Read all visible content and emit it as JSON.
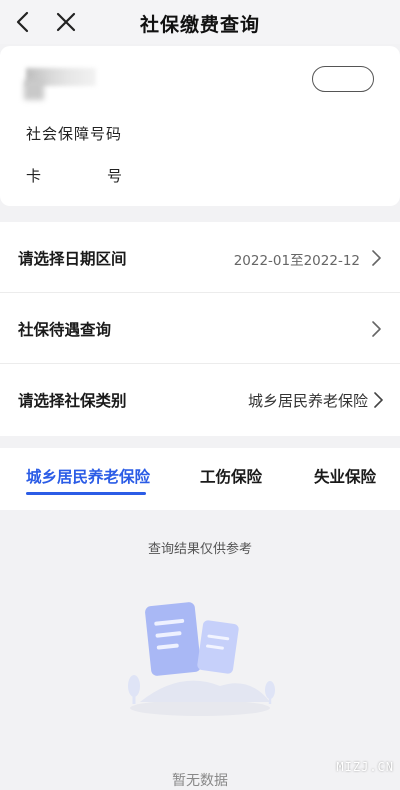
{
  "nav": {
    "title": "社保缴费查询"
  },
  "user": {
    "social_security_label": "社会保障号码",
    "card_label_left": "卡",
    "card_label_right": "号"
  },
  "rows": [
    {
      "label": "请选择日期区间",
      "value": "2022-01至2022-12"
    },
    {
      "label": "社保待遇查询",
      "value": ""
    },
    {
      "label": "请选择社保类别",
      "value": "城乡居民养老保险"
    }
  ],
  "tabs": [
    {
      "label": "城乡居民养老保险",
      "active": true
    },
    {
      "label": "工伤保险",
      "active": false
    },
    {
      "label": "失业保险",
      "active": false
    }
  ],
  "results": {
    "notice": "查询结果仅供参考",
    "empty": "暂无数据"
  },
  "watermark": "MIZJ.CN",
  "colors": {
    "accent": "#2b5ce6",
    "illustration": "#a9b8f5"
  }
}
